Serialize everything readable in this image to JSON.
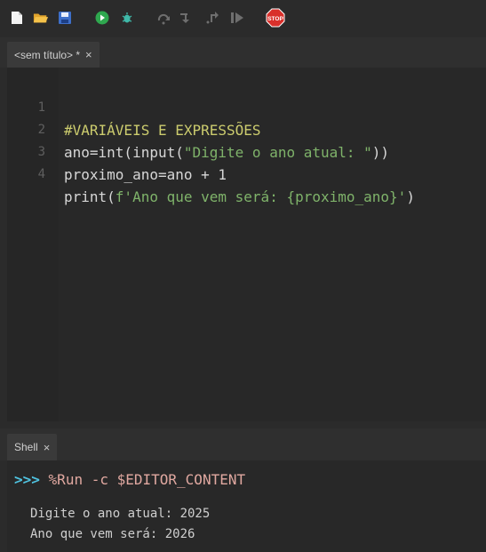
{
  "toolbar": {
    "icons": [
      "new-file-icon",
      "open-folder-icon",
      "save-icon",
      "run-icon",
      "debug-icon",
      "step-over-icon",
      "step-into-icon",
      "step-out-icon",
      "resume-icon",
      "stop-icon"
    ],
    "stop_label": "STOP"
  },
  "editor": {
    "tab_title": "<sem título> *",
    "tab_close": "×",
    "lines": [
      {
        "number": "1",
        "text": "#VARIÁVEIS E EXPRESSÕES"
      },
      {
        "number": "2",
        "pre": "ano=int(input(",
        "str": "\"Digite o ano atual: \"",
        "post": "))"
      },
      {
        "number": "3",
        "text": "proximo_ano=ano + 1"
      },
      {
        "number": "4",
        "pre": "print(",
        "str": "f'Ano que vem será: {proximo_ano}'",
        "post": ")"
      }
    ]
  },
  "shell": {
    "tab_title": "Shell",
    "tab_close": "×",
    "prompt": ">>>",
    "command": "%Run -c $EDITOR_CONTENT",
    "output": [
      "Digite o ano atual: 2025",
      "Ano que vem será: 2026"
    ]
  },
  "colors": {
    "background": "#2b2b2b",
    "comment": "#cccc6e",
    "string": "#7fb36a",
    "prompt": "#4fc3e0",
    "command": "#e0a8a0",
    "stop": "#d9302b"
  }
}
